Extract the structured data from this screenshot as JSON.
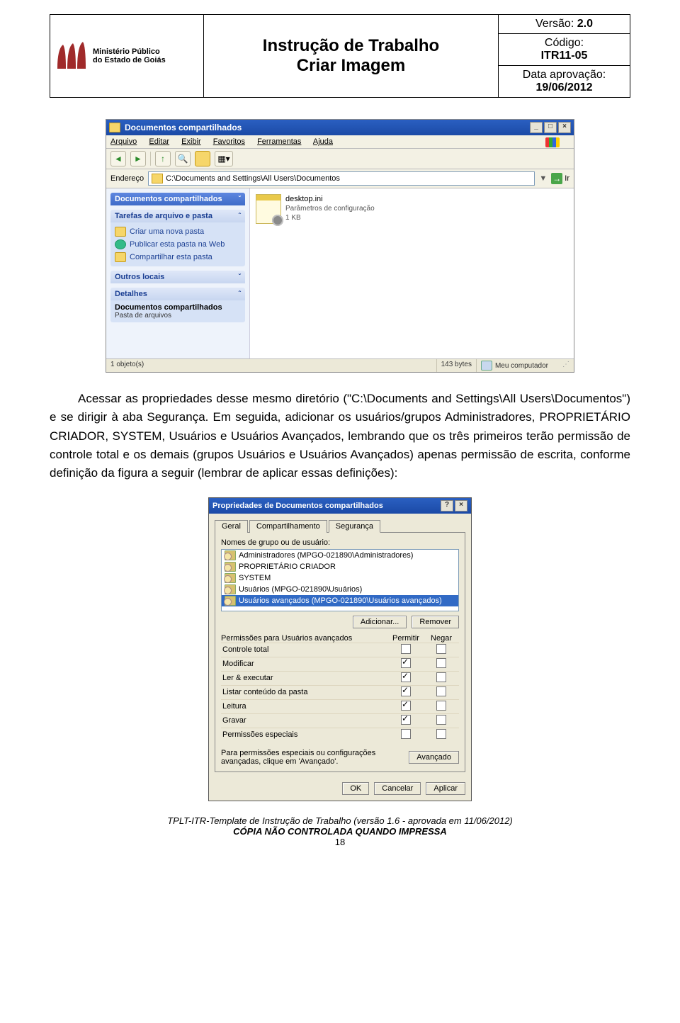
{
  "header": {
    "logo_text1": "Ministério Público",
    "logo_text2": "do Estado de Goiás",
    "title_line1": "Instrução de Trabalho",
    "title_line2": "Criar Imagem",
    "version_label": "Versão:",
    "version_value": "2.0",
    "code_label": "Código:",
    "code_value": "ITR11-05",
    "date_label": "Data aprovação:",
    "date_value": "19/06/2012"
  },
  "explorer": {
    "window_title": "Documentos compartilhados",
    "menu": {
      "arquivo": "Arquivo",
      "editar": "Editar",
      "exibir": "Exibir",
      "favoritos": "Favoritos",
      "ferramentas": "Ferramentas",
      "ajuda": "Ajuda"
    },
    "address_label": "Endereço",
    "address_value": "C:\\Documents and Settings\\All Users\\Documentos",
    "go_label": "Ir",
    "side": {
      "panel1_title": "Documentos compartilhados",
      "panel2_title": "Tarefas de arquivo e pasta",
      "task1": "Criar uma nova pasta",
      "task2": "Publicar esta pasta na Web",
      "task3": "Compartilhar esta pasta",
      "panel3_title": "Outros locais",
      "panel4_title": "Detalhes",
      "details_name": "Documentos compartilhados",
      "details_type": "Pasta de arquivos"
    },
    "file": {
      "name": "desktop.ini",
      "desc": "Parâmetros de configuração",
      "size": "1 KB"
    },
    "status_objects": "1 objeto(s)",
    "status_bytes": "143 bytes",
    "status_location": "Meu computador"
  },
  "body_text": "Acessar as propriedades desse mesmo diretório (\"C:\\Documents and Settings\\All Users\\Documentos\") e se dirigir à aba Segurança. Em seguida, adicionar os usuários/grupos Administradores, PROPRIETÁRIO CRIADOR, SYSTEM, Usuários e Usuários Avançados, lembrando que os três primeiros terão permissão de controle total e os demais (grupos Usuários e Usuários Avançados) apenas permissão de escrita, conforme definição da figura a seguir (lembrar de aplicar essas definições):",
  "props": {
    "title": "Propriedades de Documentos compartilhados",
    "tabs": {
      "geral": "Geral",
      "compart": "Compartilhamento",
      "seg": "Segurança"
    },
    "groups_label": "Nomes de grupo ou de usuário:",
    "groups": [
      "Administradores (MPGO-021890\\Administradores)",
      "PROPRIETÁRIO CRIADOR",
      "SYSTEM",
      "Usuários (MPGO-021890\\Usuários)",
      "Usuários avançados (MPGO-021890\\Usuários avançados)"
    ],
    "add_btn": "Adicionar...",
    "remove_btn": "Remover",
    "perm_label": "Permissões para Usuários avançados",
    "col_permit": "Permitir",
    "col_deny": "Negar",
    "perms": [
      {
        "name": "Controle total",
        "permit": false,
        "deny": false
      },
      {
        "name": "Modificar",
        "permit": true,
        "deny": false
      },
      {
        "name": "Ler & executar",
        "permit": true,
        "deny": false
      },
      {
        "name": "Listar conteúdo da pasta",
        "permit": true,
        "deny": false
      },
      {
        "name": "Leitura",
        "permit": true,
        "deny": false
      },
      {
        "name": "Gravar",
        "permit": true,
        "deny": false
      },
      {
        "name": "Permissões especiais",
        "permit": false,
        "deny": false
      }
    ],
    "adv_text": "Para permissões especiais ou configurações avançadas, clique em 'Avançado'.",
    "adv_btn": "Avançado",
    "ok": "OK",
    "cancel": "Cancelar",
    "apply": "Aplicar"
  },
  "footer": {
    "line1": "TPLT-ITR-Template de Instrução de Trabalho (versão 1.6 - aprovada em 11/06/2012)",
    "line2": "CÓPIA NÃO CONTROLADA QUANDO IMPRESSA",
    "page": "18"
  }
}
